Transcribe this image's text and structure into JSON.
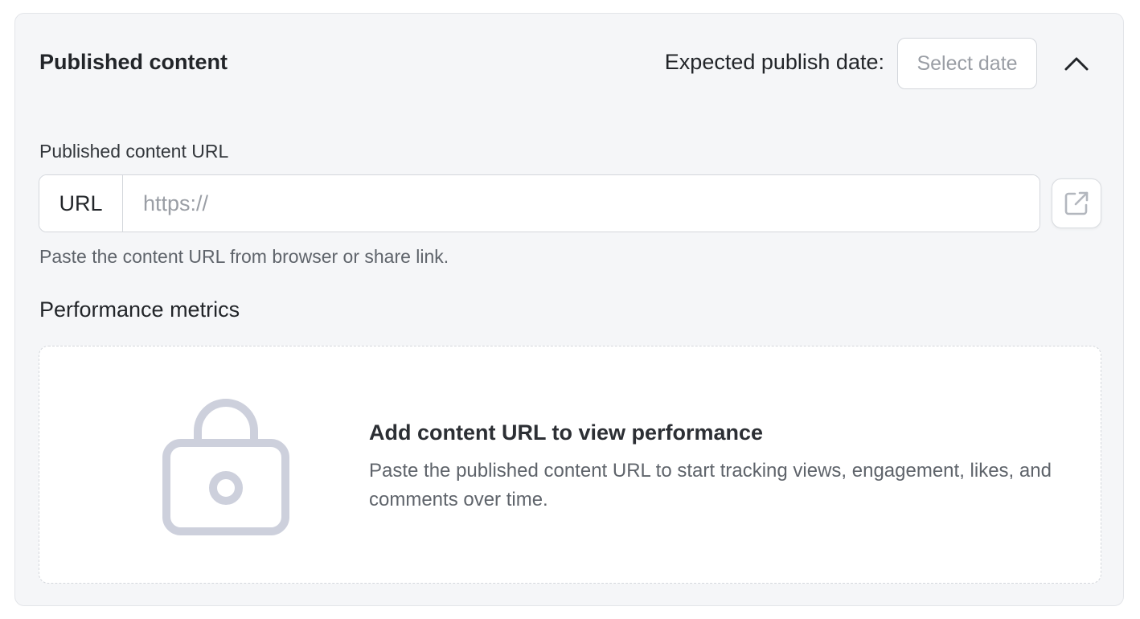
{
  "header": {
    "title": "Published content",
    "publish_date_label": "Expected publish date:",
    "date_placeholder": "Select date",
    "collapse_icon": "chevron-up-icon"
  },
  "url_field": {
    "label": "Published content URL",
    "prefix": "URL",
    "value": "",
    "placeholder": "https://",
    "helper": "Paste the content URL from browser or share link.",
    "open_icon": "external-link-icon"
  },
  "metrics": {
    "title": "Performance metrics",
    "empty_icon": "lock-icon",
    "empty_title": "Add content URL to view performance",
    "empty_description": "Paste the published content URL to start tracking views, engagement, likes, and comments over time."
  },
  "colors": {
    "card_background": "#f5f6f8",
    "border": "#d4d7dc",
    "text_primary": "#222529",
    "text_secondary": "#5f646b",
    "placeholder": "#9a9ea5",
    "lock_icon": "#cdd0dc"
  }
}
